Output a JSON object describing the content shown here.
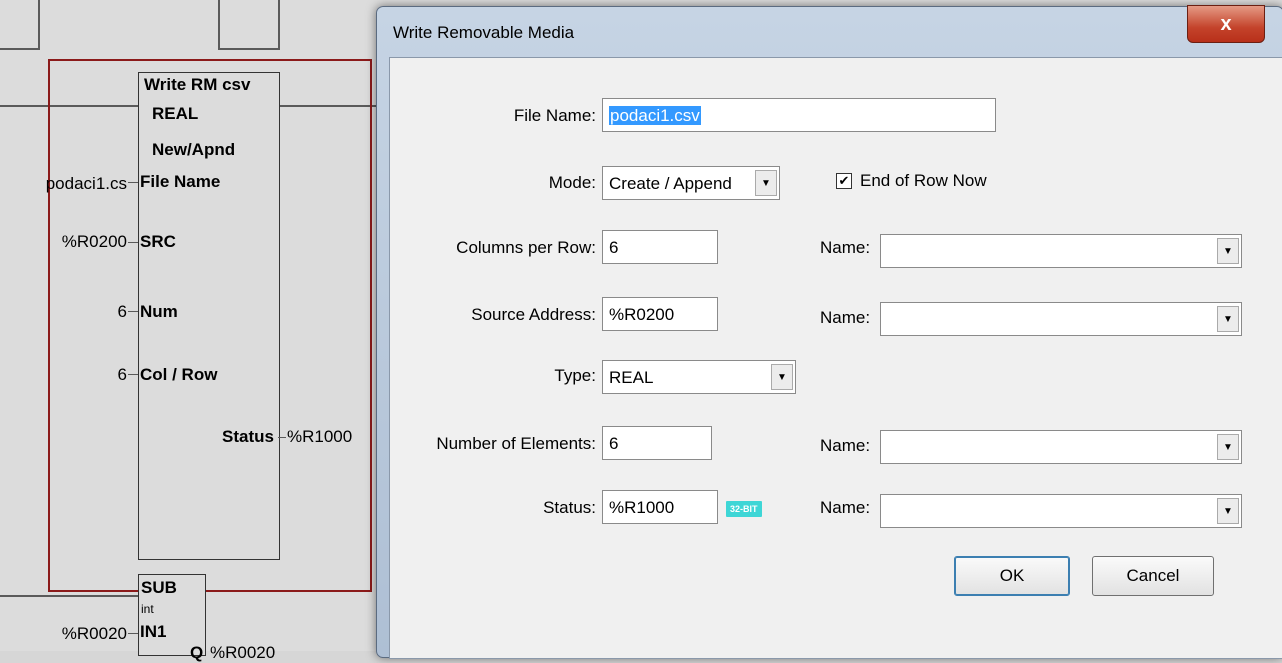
{
  "ladder": {
    "block1": {
      "title": "Write RM csv",
      "type": "REAL",
      "mode": "New/Apnd",
      "pins": [
        {
          "label": "File Name",
          "value": "podaci1.cs"
        },
        {
          "label": "SRC",
          "value": "%R0200"
        },
        {
          "label": "Num",
          "value": "6"
        },
        {
          "label": "Col / Row",
          "value": "6"
        }
      ],
      "output_label": "Status",
      "output_value": "%R1000"
    },
    "block2": {
      "title": "SUB",
      "type": "int",
      "in1_label": "IN1",
      "in1_value": "%R0020",
      "q_label": "Q",
      "q_value": "%R0020"
    }
  },
  "dialog": {
    "title": "Write Removable Media",
    "close_glyph": "x",
    "file_name_label": "File Name:",
    "file_name_value": "podaci1.csv",
    "mode_label": "Mode:",
    "mode_value": "Create / Append",
    "end_of_row_label": "End of Row Now",
    "end_of_row_checked": true,
    "columns_label": "Columns per Row:",
    "columns_value": "6",
    "source_label": "Source Address:",
    "source_value": "%R0200",
    "type_label": "Type:",
    "type_value": "REAL",
    "elements_label": "Number of Elements:",
    "elements_value": "6",
    "status_label": "Status:",
    "status_value": "%R1000",
    "bit_badge": "32-BIT",
    "name_label": "Name:",
    "ok_label": "OK",
    "cancel_label": "Cancel"
  }
}
